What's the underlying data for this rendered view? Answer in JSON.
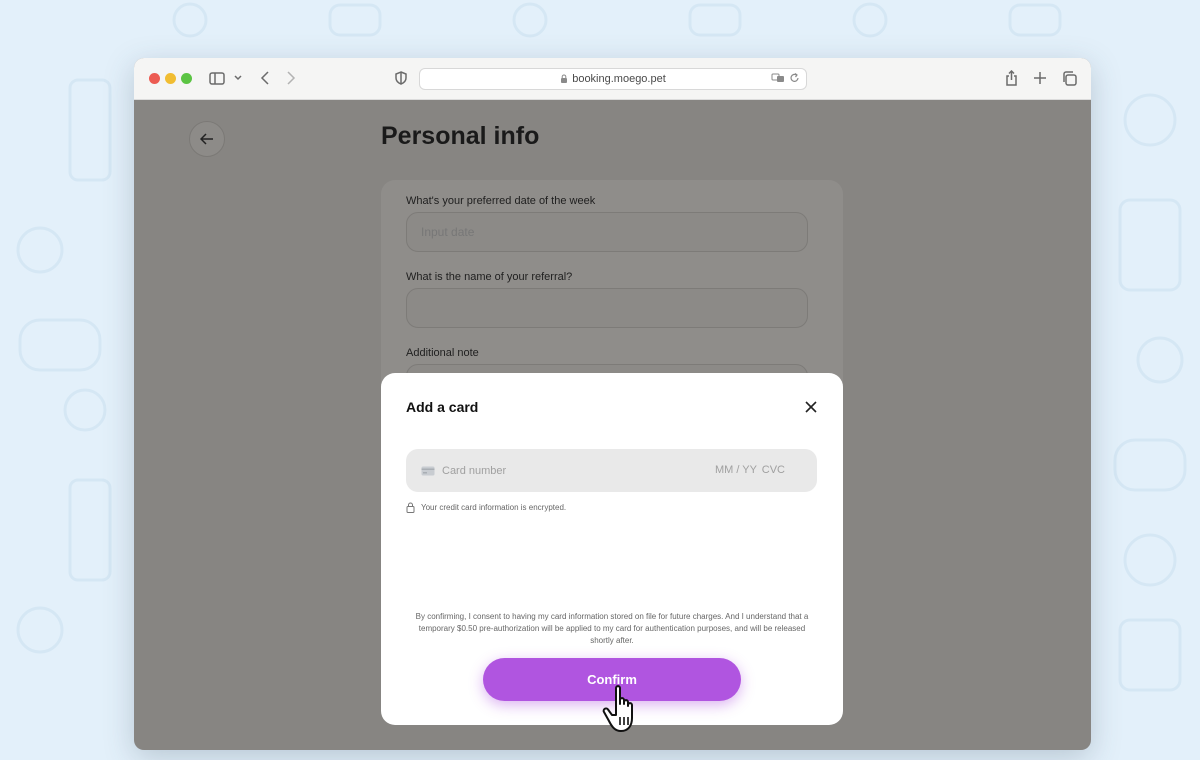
{
  "browser": {
    "url": "booking.moego.pet"
  },
  "page": {
    "title": "Personal info"
  },
  "form": {
    "preferred_date_label": "What's your preferred date of the week",
    "preferred_date_placeholder": "Input date",
    "referral_label": "What is the name of your referral?",
    "note_label": "Additional note"
  },
  "modal": {
    "title": "Add a card",
    "card_number_placeholder": "Card number",
    "expiry_placeholder": "MM / YY",
    "cvc_placeholder": "CVC",
    "encryption_note": "Your credit card information is encrypted.",
    "consent_text": "By confirming, I consent to having my card information stored on file for future charges. And I understand that a temporary $0.50 pre-authorization will be applied to my card for authentication purposes, and will be released shortly after.",
    "confirm_label": "Confirm"
  },
  "colors": {
    "accent": "#b055e0",
    "overlay": "#878582",
    "background": "#e3f0fa"
  }
}
